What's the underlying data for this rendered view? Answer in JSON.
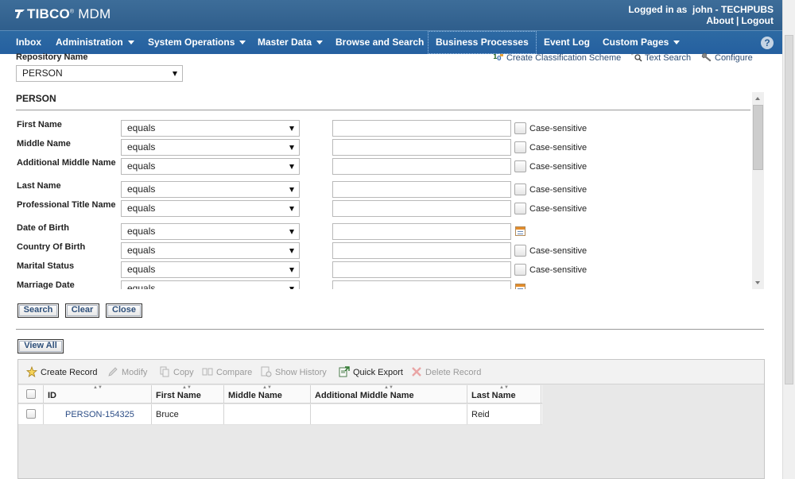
{
  "app": {
    "logo_text": "TIBCO MDM",
    "logo_brand": "TIBCO",
    "logo_product": "MDM"
  },
  "user": {
    "logged_in_label": "Logged in as",
    "username": "john - TECHPUBS",
    "about_label": "About",
    "logout_label": "Logout"
  },
  "nav": {
    "items": [
      {
        "label": "Inbox",
        "dropdown": false
      },
      {
        "label": "Administration",
        "dropdown": true
      },
      {
        "label": "System Operations",
        "dropdown": true
      },
      {
        "label": "Master Data",
        "dropdown": true
      },
      {
        "label": "Browse and Search",
        "dropdown": false
      },
      {
        "label": "Business Processes",
        "dropdown": false,
        "active": true
      },
      {
        "label": "Event Log",
        "dropdown": false
      },
      {
        "label": "Custom Pages",
        "dropdown": true
      }
    ],
    "help_label": "?"
  },
  "repository": {
    "label": "Repository Name",
    "selected": "PERSON"
  },
  "top_links": {
    "create_classification": "Create Classification Scheme",
    "text_search": "Text Search",
    "configure": "Configure"
  },
  "search_panel": {
    "title": "PERSON",
    "case_sensitive_label": "Case-sensitive",
    "fields": [
      {
        "label": "First Name",
        "operator": "equals",
        "value": "",
        "kind": "text"
      },
      {
        "label": "Middle Name",
        "operator": "equals",
        "value": "",
        "kind": "text"
      },
      {
        "label": "Additional Middle Name",
        "operator": "equals",
        "value": "",
        "kind": "text"
      },
      {
        "label": "Last Name",
        "operator": "equals",
        "value": "",
        "kind": "text"
      },
      {
        "label": "Professional Title Name",
        "operator": "equals",
        "value": "",
        "kind": "text"
      },
      {
        "label": "Date of Birth",
        "operator": "equals",
        "value": "",
        "kind": "date"
      },
      {
        "label": "Country Of Birth",
        "operator": "equals",
        "value": "",
        "kind": "text"
      },
      {
        "label": "Marital Status",
        "operator": "equals",
        "value": "",
        "kind": "text"
      },
      {
        "label": "Marriage Date",
        "operator": "equals",
        "value": "",
        "kind": "date"
      }
    ]
  },
  "buttons": {
    "search": "Search",
    "clear": "Clear",
    "close": "Close",
    "view_all": "View All"
  },
  "toolbar": {
    "create_record": "Create Record",
    "modify": "Modify",
    "copy": "Copy",
    "compare": "Compare",
    "show_history": "Show History",
    "quick_export": "Quick Export",
    "delete_record": "Delete Record"
  },
  "grid": {
    "columns": [
      "ID",
      "First Name",
      "Middle Name",
      "Additional Middle Name",
      "Last Name"
    ],
    "rows": [
      {
        "id": "PERSON-154325",
        "first_name": "Bruce",
        "middle_name": "",
        "additional_middle_name": "",
        "last_name": "Reid"
      }
    ]
  },
  "colors": {
    "header_bg": "#2f5e8c",
    "nav_bg": "#2560a0",
    "link": "#2c4d75"
  }
}
